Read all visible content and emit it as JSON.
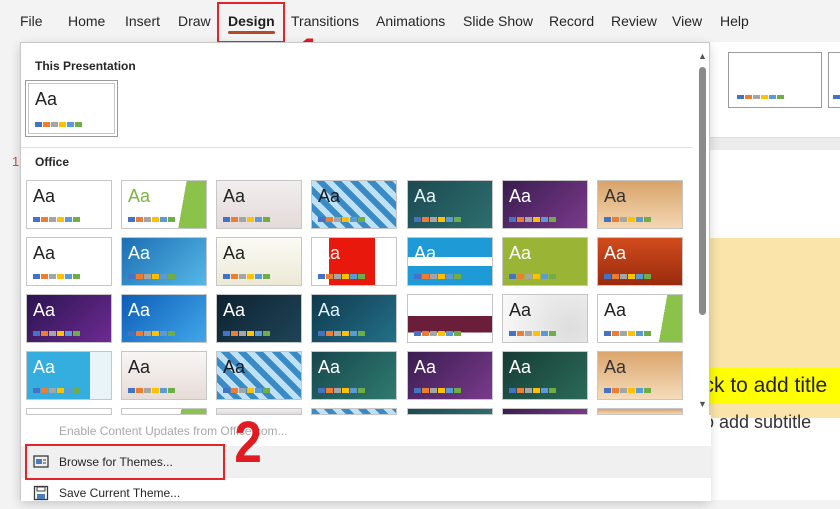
{
  "tabs": [
    {
      "label": "File",
      "active": false
    },
    {
      "label": "Home",
      "active": false
    },
    {
      "label": "Insert",
      "active": false
    },
    {
      "label": "Draw",
      "active": false
    },
    {
      "label": "Design",
      "active": true
    },
    {
      "label": "Transitions",
      "active": false
    },
    {
      "label": "Animations",
      "active": false
    },
    {
      "label": "Slide Show",
      "active": false
    },
    {
      "label": "Record",
      "active": false
    },
    {
      "label": "Review",
      "active": false
    },
    {
      "label": "View",
      "active": false
    },
    {
      "label": "Help",
      "active": false
    }
  ],
  "annotations": {
    "step1": "1",
    "step2": "2"
  },
  "slide_number": "1",
  "gallery": {
    "this_presentation_label": "This Presentation",
    "office_label": "Office",
    "thumb_text": "Aa"
  },
  "menu": {
    "enable_updates": "Enable Content Updates from Office.com...",
    "browse": "Browse for Themes...",
    "save": "Save Current Theme..."
  },
  "slide": {
    "title_placeholder": "Click to add title",
    "subtitle_placeholder": "Click to add subtitle"
  },
  "colors": {
    "accent": "#b7472a",
    "highlight_box": "#e0262b"
  }
}
